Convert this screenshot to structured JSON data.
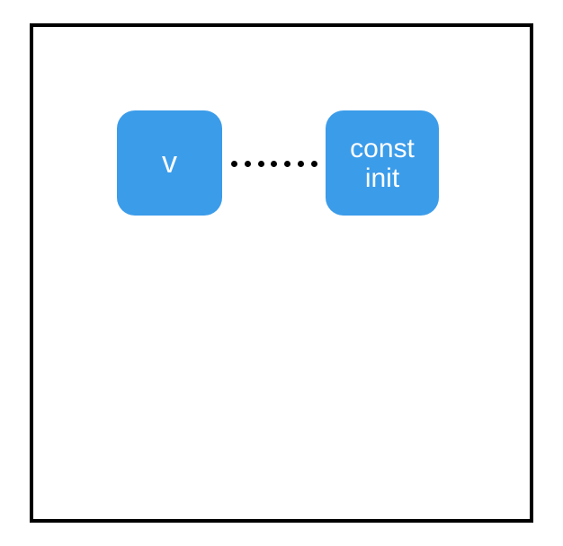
{
  "diagram": {
    "nodeA_label": "v",
    "nodeB_line1": "const",
    "nodeB_line2": "init"
  }
}
